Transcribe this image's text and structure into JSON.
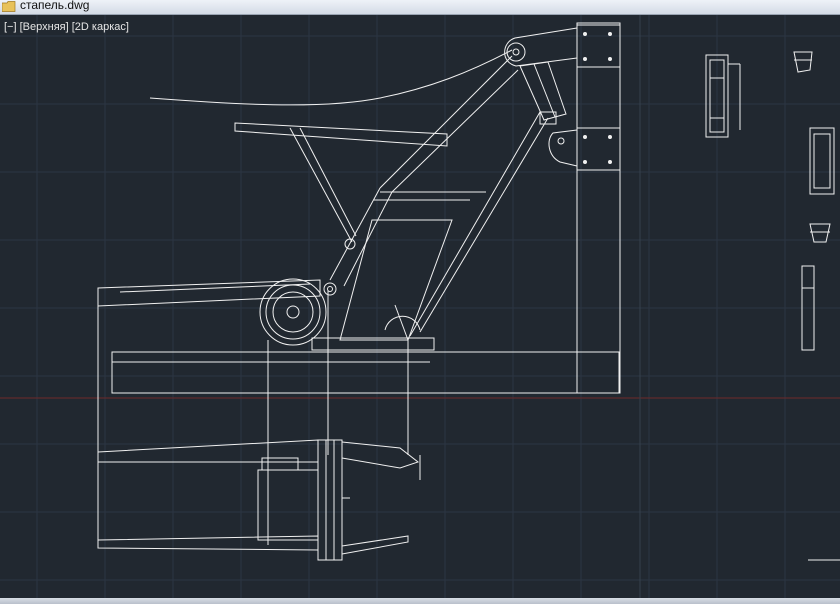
{
  "window": {
    "file_name": "стапель.dwg",
    "file_icon": "folder-icon"
  },
  "viewport": {
    "controls": {
      "minus": "[−]",
      "view": "[Верхняя]",
      "style": "[2D каркас]"
    },
    "colors": {
      "background": "#212830",
      "grid": "#2a3440",
      "lines": "#f2f2f2",
      "axis_x": "#6e2a2a"
    }
  }
}
